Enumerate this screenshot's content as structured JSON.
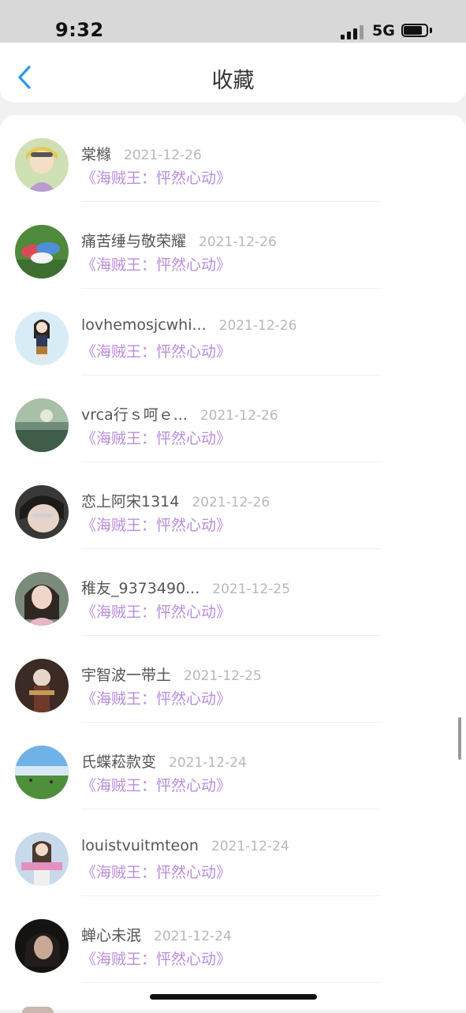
{
  "status_bar": {
    "time": "9:32",
    "network": "5G"
  },
  "header": {
    "title": "收藏"
  },
  "favorites": [
    {
      "username": "棠橼",
      "date": "2021-12-26",
      "title": "《海贼王：怦然心动》",
      "avatar_icon": "anime-girl-avatar"
    },
    {
      "username": "痛苦缍与敬荣耀",
      "date": "2021-12-26",
      "title": "《海贼王：怦然心动》",
      "avatar_icon": "colorful-hats-avatar"
    },
    {
      "username": "lovhemosjcwhi...",
      "date": "2021-12-26",
      "title": "《海贼王：怦然心动》",
      "avatar_icon": "cartoon-girl-avatar"
    },
    {
      "username": "vrca行ｓ呵ｅ...",
      "date": "2021-12-26",
      "title": "《海贼王：怦然心动》",
      "avatar_icon": "misty-landscape-avatar"
    },
    {
      "username": "恋上阿宋1314",
      "date": "2021-12-26",
      "title": "《海贼王：怦然心动》",
      "avatar_icon": "portrait-avatar"
    },
    {
      "username": "稚友_9373490...",
      "date": "2021-12-25",
      "title": "《海贼王：怦然心动》",
      "avatar_icon": "portrait-avatar"
    },
    {
      "username": "宇智波一带土",
      "date": "2021-12-25",
      "title": "《海贼王：怦然心动》",
      "avatar_icon": "anime-character-avatar"
    },
    {
      "username": "氏蝶菘款变",
      "date": "2021-12-24",
      "title": "《海贼王：怦然心动》",
      "avatar_icon": "sky-meadow-avatar"
    },
    {
      "username": "louistvuitmteon",
      "date": "2021-12-24",
      "title": "《海贼王：怦然心动》",
      "avatar_icon": "colorful-girl-avatar"
    },
    {
      "username": "蝉心未泯",
      "date": "2021-12-24",
      "title": "《海贼王：怦然心动》",
      "avatar_icon": "dark-portrait-avatar"
    }
  ],
  "colors": {
    "title_purple": "#b98ddb",
    "back_blue": "#2f97e6",
    "date_gray": "#b8b8b8"
  }
}
